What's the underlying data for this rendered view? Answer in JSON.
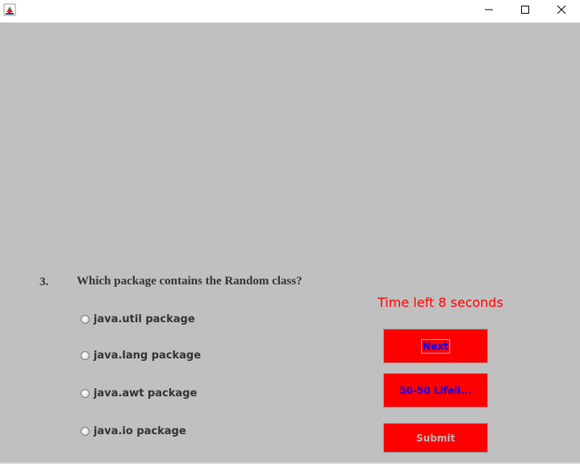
{
  "titlebar": {
    "app_icon": "java-cup-icon",
    "minimize_icon": "minimize-icon",
    "maximize_icon": "maximize-icon",
    "close_icon": "close-icon"
  },
  "question": {
    "number": "3.",
    "text": "Which package contains the Random class?"
  },
  "timer": {
    "text": "Time left 8 seconds"
  },
  "options": [
    {
      "label": "java.util package",
      "selected": false
    },
    {
      "label": "java.lang package",
      "selected": false
    },
    {
      "label": "java.awt package",
      "selected": false
    },
    {
      "label": "java.io package",
      "selected": false
    }
  ],
  "buttons": {
    "next": "Next",
    "lifeline": "50-50 Lifeli...",
    "submit": "Submit"
  },
  "colors": {
    "panel_background": "#c0c0c0",
    "button_background": "#ff0000",
    "button_text": "#0000ff",
    "timer_text": "#ff0000",
    "disabled_text": "#b8b8b8"
  }
}
